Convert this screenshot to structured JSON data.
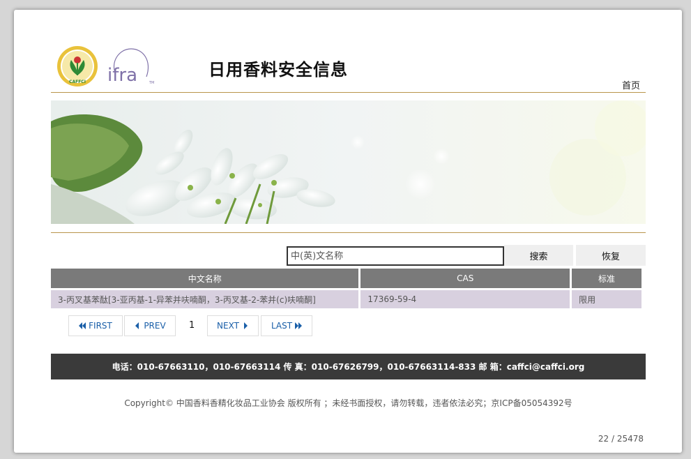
{
  "header": {
    "title": "日用香料安全信息",
    "home_link": "首页",
    "logo1_text": "中国香料香精化妆品工业协会",
    "logo1_abbr": "CAFFCI",
    "logo2_text": "ifra",
    "logo2_tm": "TM"
  },
  "search": {
    "placeholder": "中(英)文名称",
    "value": "",
    "search_label": "搜索",
    "reset_label": "恢复"
  },
  "table": {
    "columns": [
      "中文名称",
      "CAS",
      "标准"
    ],
    "rows": [
      [
        "3-丙叉基苯酞[3-亚丙基-1-异苯并呋喃酮，3-丙叉基-2-苯并(c)呋喃酮]",
        "17369-59-4",
        "限用"
      ]
    ]
  },
  "pagination": {
    "first": "FIRST",
    "prev": "PREV",
    "current": "1",
    "next": "NEXT",
    "last": "LAST"
  },
  "footer": {
    "contact": "电话：010-67663110，010-67663114 传 真：010-67626799，010-67663114-833 邮 箱：caffci@caffci.org",
    "copyright": "Copyright© 中国香料香精化妆品工业协会 版权所有 ；未经书面授权，请勿转载，违者依法必究；京ICP备05054392号",
    "counter": "22 / 25478"
  },
  "colors": {
    "accent_rule": "#b9954a",
    "table_header": "#7a7a7a",
    "table_row": "#d8d0df",
    "footer_bar": "#3a3a3a",
    "pager_text": "#1a5fa8"
  }
}
